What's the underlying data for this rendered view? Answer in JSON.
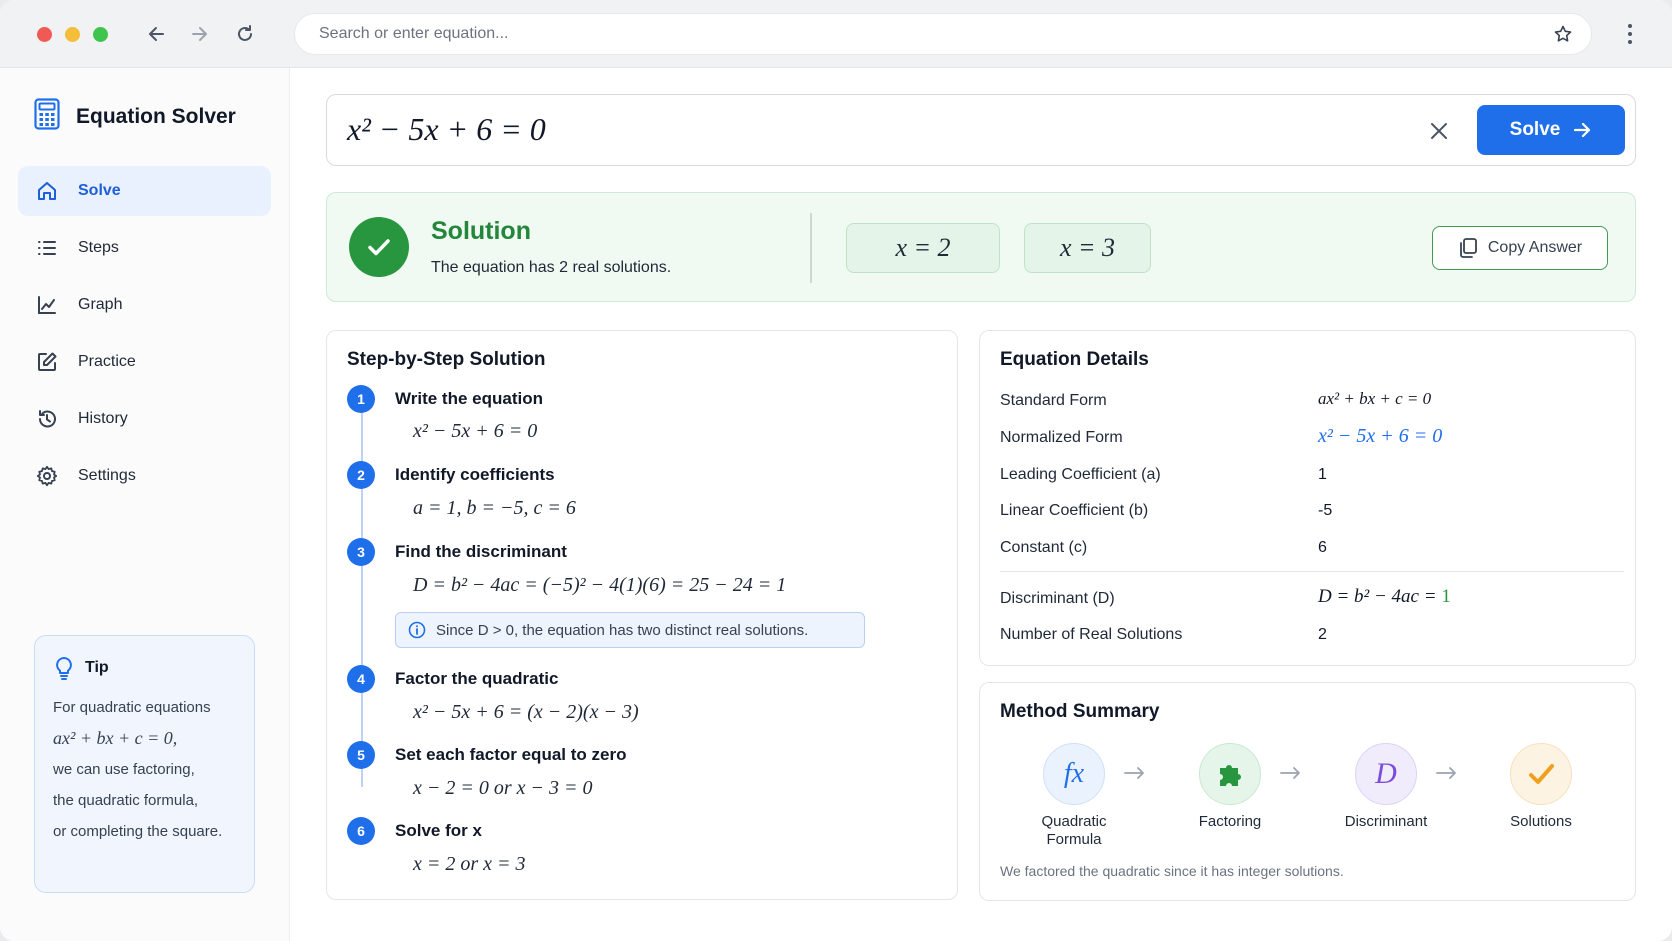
{
  "app": {
    "title": "Equation Solver"
  },
  "browser": {
    "search_placeholder": "Search or enter equation..."
  },
  "sidebar": {
    "items": [
      {
        "label": "Solve",
        "icon": "home-icon",
        "active": true
      },
      {
        "label": "Steps",
        "icon": "list-icon"
      },
      {
        "label": "Graph",
        "icon": "chart-line-icon"
      },
      {
        "label": "Practice",
        "icon": "edit-icon"
      },
      {
        "label": "History",
        "icon": "history-icon"
      },
      {
        "label": "Settings",
        "icon": "gear-icon"
      }
    ],
    "tip": {
      "title": "Tip",
      "line1": "For quadratic equations",
      "math": "ax² + bx + c = 0,",
      "line2": "we can use factoring,",
      "line3": "the quadratic formula,",
      "line4": "or completing the square."
    }
  },
  "input": {
    "equation": "x² − 5x + 6 = 0",
    "solve_label": "Solve"
  },
  "solution": {
    "title": "Solution",
    "subtitle": "The equation has 2 real solutions.",
    "roots": [
      "x = 2",
      "x = 3"
    ],
    "copy_label": "Copy Answer"
  },
  "steps": {
    "title": "Step-by-Step Solution",
    "items": [
      {
        "num": "1",
        "title": "Write the equation",
        "math": "x² − 5x + 6 = 0"
      },
      {
        "num": "2",
        "title": "Identify coefficients",
        "math": "a = 1,  b = −5,  c = 6"
      },
      {
        "num": "3",
        "title": "Find the discriminant",
        "math": "D = b² − 4ac = (−5)² − 4(1)(6) = 25 − 24 = 1"
      },
      {
        "num": "4",
        "title": "Factor the quadratic",
        "math": "x² − 5x + 6 = (x − 2)(x − 3)"
      },
      {
        "num": "5",
        "title": "Set each factor equal to zero",
        "math": "x − 2 = 0   or   x − 3 = 0"
      },
      {
        "num": "6",
        "title": "Solve for x",
        "math": "x = 2   or   x = 3"
      }
    ],
    "note": "Since D > 0, the equation has two distinct real solutions."
  },
  "details": {
    "title": "Equation Details",
    "rows": [
      {
        "label": "Standard Form",
        "value": "ax² + bx + c = 0"
      },
      {
        "label": "Normalized Form",
        "value": "x² − 5x + 6 = 0"
      },
      {
        "label": "Leading Coefficient (a)",
        "value": "1"
      },
      {
        "label": "Linear Coefficient (b)",
        "value": "-5"
      },
      {
        "label": "Constant (c)",
        "value": "6"
      },
      {
        "label": "Discriminant (D)",
        "value_prefix": "D = b² − 4ac = ",
        "value_highlight": "1"
      },
      {
        "label": "Number of Real Solutions",
        "value": "2"
      }
    ]
  },
  "method": {
    "title": "Method Summary",
    "items": [
      {
        "label": "Quadratic Formula",
        "icon": "fx-icon",
        "glyph": "fx"
      },
      {
        "label": "Factoring",
        "icon": "puzzle-icon"
      },
      {
        "label": "Discriminant",
        "icon": "d-icon",
        "glyph": "D"
      },
      {
        "label": "Solutions",
        "icon": "checkmark-icon"
      }
    ],
    "footer": "We factored the quadratic since it has integer solutions."
  },
  "colors": {
    "accent": "#1f6feb",
    "success": "#27963e",
    "method_blue": "#eaf2fd",
    "method_green": "#e6f5e9",
    "method_purple": "#f1ecfb",
    "method_orange": "#fdf3e3"
  }
}
